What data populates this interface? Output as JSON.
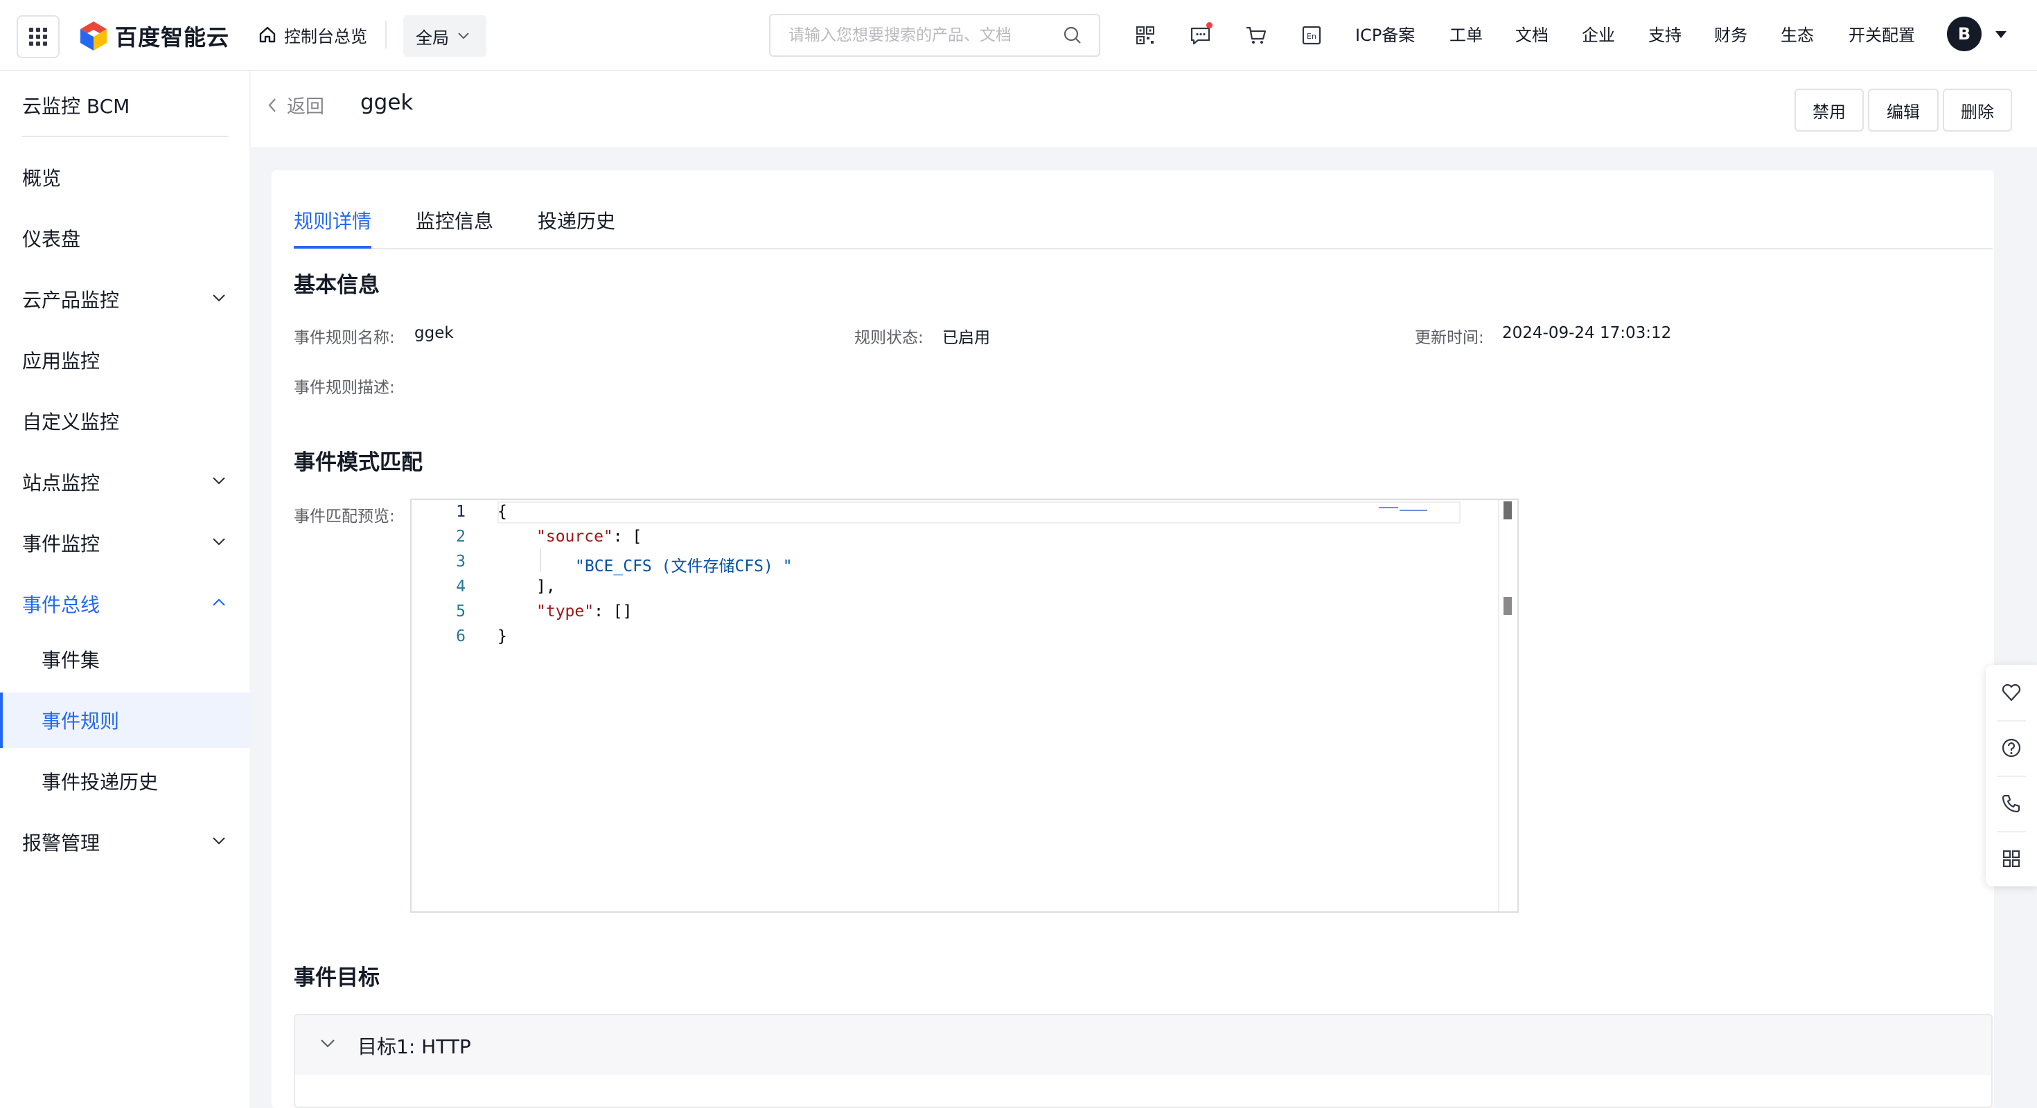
{
  "header": {
    "logo_text": "百度智能云",
    "console_home": "控制台总览",
    "region": "全局",
    "search_placeholder": "请输入您想要搜索的产品、文档",
    "links": [
      "ICP备案",
      "工单",
      "文档",
      "企业",
      "支持",
      "财务",
      "生态",
      "开关配置"
    ],
    "avatar_letter": "B",
    "icons": [
      "qrcode-icon",
      "message-icon",
      "cart-icon",
      "language-icon"
    ],
    "language_badge": "En"
  },
  "sidebar": {
    "title": "云监控 BCM",
    "items": [
      {
        "label": "概览",
        "expandable": false
      },
      {
        "label": "仪表盘",
        "expandable": false
      },
      {
        "label": "云产品监控",
        "expandable": true
      },
      {
        "label": "应用监控",
        "expandable": false
      },
      {
        "label": "自定义监控",
        "expandable": false
      },
      {
        "label": "站点监控",
        "expandable": true
      },
      {
        "label": "事件监控",
        "expandable": true
      },
      {
        "label": "事件总线",
        "expandable": true,
        "expanded": true
      },
      {
        "label": "事件集",
        "sub": true
      },
      {
        "label": "事件规则",
        "sub": true,
        "active": true
      },
      {
        "label": "事件投递历史",
        "sub": true
      },
      {
        "label": "报警管理",
        "expandable": true
      }
    ]
  },
  "page": {
    "back_label": "返回",
    "title": "ggek",
    "actions": [
      "禁用",
      "编辑",
      "删除"
    ]
  },
  "tabs": [
    "规则详情",
    "监控信息",
    "投递历史"
  ],
  "active_tab": "规则详情",
  "basic_info": {
    "section_title": "基本信息",
    "rule_name_label": "事件规则名称:",
    "rule_name": "ggek",
    "rule_status_label": "规则状态:",
    "rule_status": "已启用",
    "updated_label": "更新时间:",
    "updated_at": "2024-09-24 17:03:12",
    "description_label": "事件规则描述:",
    "description": ""
  },
  "event_pattern": {
    "section_title": "事件模式匹配",
    "preview_label": "事件匹配预览:",
    "line_numbers": [
      "1",
      "2",
      "3",
      "4",
      "5",
      "6"
    ],
    "code": {
      "l1": "{",
      "l2_key": "\"source\"",
      "l2_rest": ": [",
      "l3": "\"BCE_CFS (文件存储CFS) \"",
      "l4": "],",
      "l5_key": "\"type\"",
      "l5_rest": ": []",
      "l6": "}"
    }
  },
  "event_target": {
    "section_title": "事件目标",
    "target_title": "目标1: HTTP"
  },
  "float_tools": [
    "heart-icon",
    "help-icon",
    "phone-icon",
    "apps-grid-icon"
  ],
  "colors": {
    "accent": "#2468f2",
    "text": "#151b26",
    "muted": "#84868c",
    "background": "#f3f4f7"
  }
}
